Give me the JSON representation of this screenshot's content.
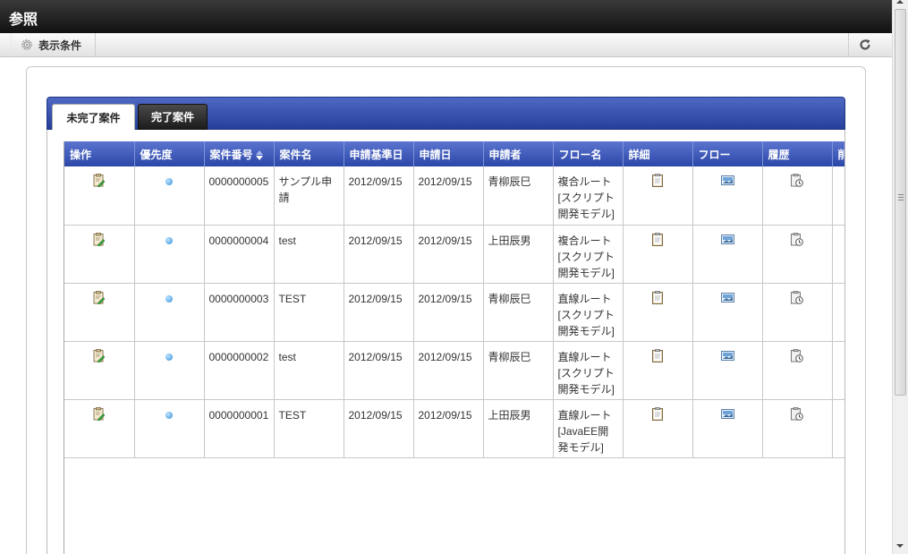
{
  "window": {
    "title": "参照"
  },
  "toolbar": {
    "conditions_label": "表示条件",
    "icons": {
      "conditions": "gear-icon",
      "refresh": "refresh-icon"
    }
  },
  "tabs": [
    {
      "label": "未完了案件",
      "active": true
    },
    {
      "label": "完了案件",
      "active": false
    }
  ],
  "table": {
    "columns": [
      "操作",
      "優先度",
      "案件番号",
      "案件名",
      "申請基準日",
      "申請日",
      "申請者",
      "フロー名",
      "詳細",
      "フロー",
      "履歴",
      "削"
    ],
    "sorted_column": "案件番号",
    "rows": [
      {
        "number": "0000000005",
        "name": "サンプル申請",
        "base_date": "2012/09/15",
        "date": "2012/09/15",
        "applicant": "青柳辰巳",
        "flow": "複合ルート[スクリプト開発モデル]"
      },
      {
        "number": "0000000004",
        "name": "test",
        "base_date": "2012/09/15",
        "date": "2012/09/15",
        "applicant": "上田辰男",
        "flow": "複合ルート[スクリプト開発モデル]"
      },
      {
        "number": "0000000003",
        "name": "TEST",
        "base_date": "2012/09/15",
        "date": "2012/09/15",
        "applicant": "青柳辰巳",
        "flow": "直線ルート[スクリプト開発モデル]"
      },
      {
        "number": "0000000002",
        "name": "test",
        "base_date": "2012/09/15",
        "date": "2012/09/15",
        "applicant": "青柳辰巳",
        "flow": "直線ルート[スクリプト開発モデル]"
      },
      {
        "number": "0000000001",
        "name": "TEST",
        "base_date": "2012/09/15",
        "date": "2012/09/15",
        "applicant": "上田辰男",
        "flow": "直線ルート[JavaEE開発モデル]"
      }
    ],
    "row_icons": {
      "operation": "edit-icon",
      "priority": "priority-dot-icon",
      "detail": "clipboard-icon",
      "flow": "flow-image-icon",
      "history": "history-icon",
      "delete": "trash-icon"
    }
  },
  "colors": {
    "title_bar": "#1a1a1a",
    "tab_bar": "#2b47a8",
    "header": "#3f5abd",
    "priority_dot": "#2f8fd8"
  }
}
